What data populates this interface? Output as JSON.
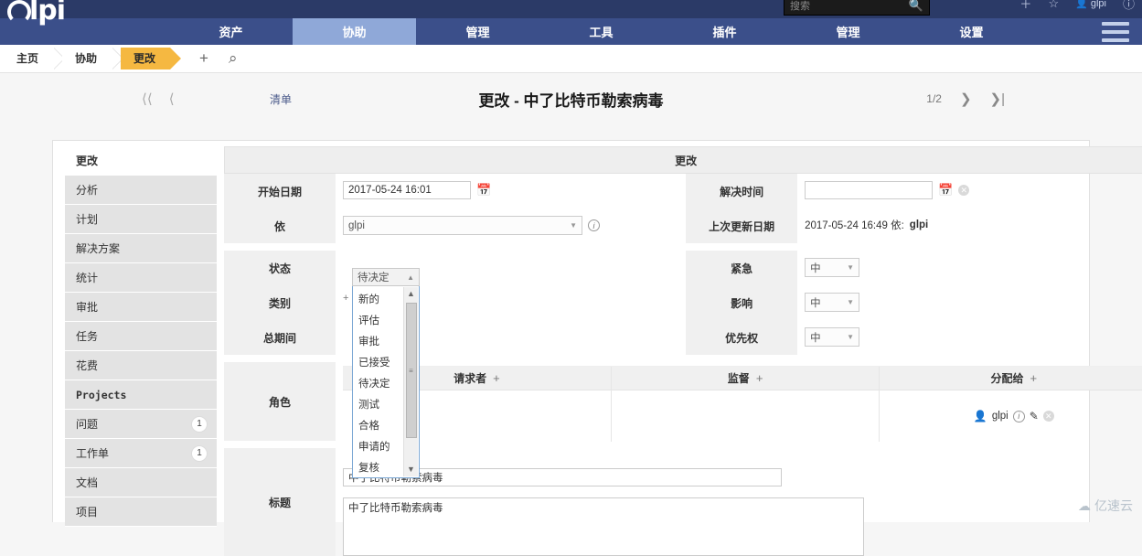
{
  "header": {
    "logo_text": "lpi",
    "search_placeholder": "搜索",
    "search_icon": "search-icon",
    "nav": [
      {
        "label": "资产",
        "active": false
      },
      {
        "label": "协助",
        "active": true
      },
      {
        "label": "管理",
        "active": false
      },
      {
        "label": "工具",
        "active": false
      },
      {
        "label": "插件",
        "active": false
      },
      {
        "label": "管理",
        "active": false
      },
      {
        "label": "设置",
        "active": false
      }
    ]
  },
  "breadcrumb": {
    "items": [
      {
        "label": "主页",
        "active": false
      },
      {
        "label": "协助",
        "active": false
      },
      {
        "label": "更改",
        "active": true
      }
    ],
    "add_label": "+",
    "search_label": "⌕"
  },
  "titlebar": {
    "first_label": "⟨⟨",
    "prev_label": "⟨",
    "list_label": "清单",
    "title": "更改 - 中了比特币勒索病毒",
    "counter": "1/2",
    "next_label": "❯",
    "last_label": "❯|"
  },
  "sidebar": {
    "items": [
      {
        "label": "更改",
        "badge": "",
        "active": true
      },
      {
        "label": "分析",
        "badge": "",
        "active": false
      },
      {
        "label": "计划",
        "badge": "",
        "active": false
      },
      {
        "label": "解决方案",
        "badge": "",
        "active": false
      },
      {
        "label": "统计",
        "badge": "",
        "active": false
      },
      {
        "label": "审批",
        "badge": "",
        "active": false
      },
      {
        "label": "任务",
        "badge": "",
        "active": false
      },
      {
        "label": "花费",
        "badge": "",
        "active": false
      },
      {
        "label": "Projects",
        "badge": "",
        "active": false
      },
      {
        "label": "问题",
        "badge": "1",
        "active": false
      },
      {
        "label": "工作单",
        "badge": "1",
        "active": false
      },
      {
        "label": "文档",
        "badge": "",
        "active": false
      },
      {
        "label": "项目",
        "badge": "",
        "active": false
      }
    ]
  },
  "form": {
    "header": "更改",
    "start_date": {
      "label": "开始日期",
      "value": "2017-05-24 16:01",
      "calendar_icon": "calendar-icon"
    },
    "by": {
      "label": "依",
      "value": "glpi",
      "info_icon": "info-icon"
    },
    "status": {
      "label": "状态",
      "value": "待决定"
    },
    "category": {
      "label": "类别"
    },
    "duration": {
      "label": "总期间"
    },
    "roles": {
      "label": "角色"
    },
    "title_field": {
      "label": "标题",
      "value": "中了比特币勒索病毒"
    },
    "description_value": "中了比特币勒索病毒",
    "resolve_time": {
      "label": "解决时间",
      "value": "",
      "calendar_icon": "calendar-icon",
      "clear_icon": "clear-icon"
    },
    "last_update": {
      "label": "上次更新日期",
      "value": "2017-05-24 16:49 依:",
      "author": "glpi"
    },
    "urgency": {
      "label": "紧急",
      "value": "中"
    },
    "impact": {
      "label": "影响",
      "value": "中"
    },
    "priority": {
      "label": "优先权",
      "value": "中"
    }
  },
  "actors": {
    "columns": [
      {
        "label": "请求者",
        "add": "+",
        "user": ""
      },
      {
        "label": "监督",
        "add": "+",
        "user": ""
      },
      {
        "label": "分配给",
        "add": "+",
        "user": "glpi"
      }
    ]
  },
  "status_dropdown": {
    "selected": "待决定",
    "options": [
      "新的",
      "评估",
      "审批",
      "已接受",
      "待决定",
      "测试",
      "合格",
      "申请的",
      "复核"
    ]
  },
  "watermark": {
    "text": "亿速云",
    "icon": "cloud-icon"
  },
  "colors": {
    "topbar": "#2b3a67",
    "nav": "#3b4f8a",
    "nav_active": "#8fa8d8",
    "crumb_active": "#f5b841",
    "link": "#1b3a8c"
  }
}
